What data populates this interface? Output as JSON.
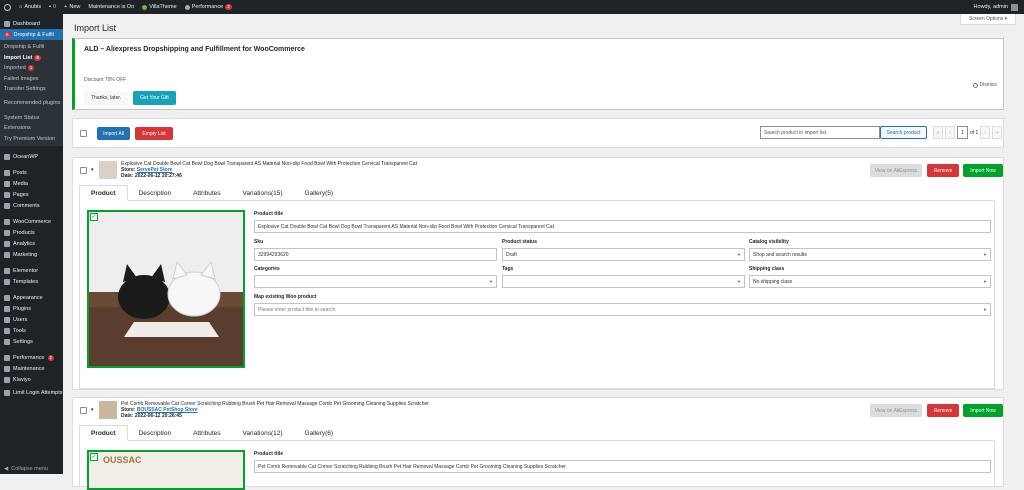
{
  "adminbar": {
    "site_name": "Anubis",
    "comments_count": "0",
    "new_label": "New",
    "maintenance": "Maintenance is On",
    "theme": "VillaTheme",
    "performance": "Performance",
    "performance_count": "2",
    "howdy": "Howdy, admin"
  },
  "sidebar": {
    "dashboard": "Dashboard",
    "dropship": "Dropship & Fulfil",
    "dropship_badge": "6",
    "sub": [
      {
        "label": "Dropship & Fulfil"
      },
      {
        "label": "Import List",
        "badge": "6"
      },
      {
        "label": "Imported",
        "badge": "1"
      },
      {
        "label": "Failed Images"
      },
      {
        "label": "Transfer Settings"
      },
      {
        "label": "Recommended plugins"
      },
      {
        "label": "System Status"
      },
      {
        "label": "Extensions"
      },
      {
        "label": "Try Premium Version"
      }
    ],
    "items": [
      {
        "label": "OceanWP"
      },
      {
        "label": "Posts"
      },
      {
        "label": "Media"
      },
      {
        "label": "Pages"
      },
      {
        "label": "Comments"
      },
      {
        "label": "WooCommerce"
      },
      {
        "label": "Products"
      },
      {
        "label": "Analytics"
      },
      {
        "label": "Marketing"
      },
      {
        "label": "Elementor"
      },
      {
        "label": "Templates"
      },
      {
        "label": "Appearance"
      },
      {
        "label": "Plugins"
      },
      {
        "label": "Users"
      },
      {
        "label": "Tools"
      },
      {
        "label": "Settings"
      },
      {
        "label": "Performance",
        "badge": "2"
      },
      {
        "label": "Maintenance"
      },
      {
        "label": "Klaviyo"
      },
      {
        "label": "Limit Login Attempts"
      }
    ],
    "collapse": "Collapse menu"
  },
  "page": {
    "title": "Import List",
    "screen_options": "Screen Options ▾"
  },
  "notice": {
    "title": "ALD – Aliexpress Dropshipping and Fulfillment for WooCommerce",
    "discount": "Discount 70% OFF",
    "later": "Thanks, later.",
    "gift": "Get Your Gift",
    "dismiss": "Dismiss"
  },
  "toolbar": {
    "import_all": "Import All",
    "empty_list": "Empty List",
    "search_placeholder": "Search product in import list",
    "search_button": "Search product",
    "page_current": "1",
    "page_of": "of 1"
  },
  "products": [
    {
      "title": "Explosive Cat Double Bowl Cat Bowl Dog Bowl Transparent AS Material Non-slip Food Bowl With Protection Cervical Transparent Cat",
      "store_label": "Store:",
      "store": "ServePet Store",
      "date": "Date: 2022-06-12 20:27:46",
      "view": "View on AliExpress",
      "remove": "Remove",
      "import": "Import Now",
      "tabs": [
        "Product",
        "Description",
        "Attributes",
        "Variations(15)",
        "Gallery(5)"
      ],
      "fields": {
        "title_label": "Product title",
        "title_value": "Explosive Cat Double Bowl Cat Bowl Dog Bowl Transparent AS Material Non-slip Food Bowl With Protection Cervical Transparent Cat",
        "sku_label": "Sku",
        "sku_value": "32994293620",
        "status_label": "Product status",
        "status_value": "Draft",
        "visibility_label": "Catalog visibility",
        "visibility_value": "Shop and search results",
        "categories_label": "Categories",
        "tags_label": "Tags",
        "shipping_label": "Shipping class",
        "shipping_value": "No shipping class",
        "map_label": "Map existing Woo product",
        "map_placeholder": "Please enter product title to search"
      }
    },
    {
      "title": "Pet Comb Removable Cat Corner Scratching Rubbing Brush Pet Hair Removal Massage Comb Pet Grooming Cleaning Supplies Scratcher",
      "store_label": "Store:",
      "store": "BOUSSAC PetShop Store",
      "date": "Date: 2022-06-12 20:26:45",
      "view": "View on AliExpress",
      "remove": "Remove",
      "import": "Import Now",
      "tabs": [
        "Product",
        "Description",
        "Attributes",
        "Variations(12)",
        "Gallery(6)"
      ],
      "fields": {
        "title_label": "Product title",
        "title_value": "Pet Comb Removable Cat Corner Scratching Rubbing Brush Pet Hair Removal Massage Comb Pet Grooming Cleaning Supplies Scratcher",
        "image_text": "OUSSAC"
      }
    }
  ],
  "colors": {
    "admin_dark": "#1d2327",
    "accent_blue": "#2271b1",
    "danger_red": "#d63638",
    "success_green": "#00a32a",
    "gift_teal": "#17a2b8"
  }
}
